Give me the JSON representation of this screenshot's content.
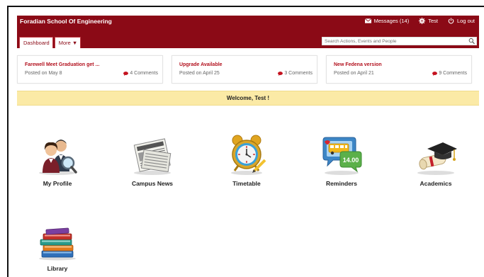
{
  "header": {
    "school_name": "Foradian School Of Engineering",
    "messages_label": "Messages (14)",
    "user_label": "Test",
    "logout_label": "Log out",
    "search_placeholder": "Search Actions, Events and People"
  },
  "tabs": [
    {
      "label": "Dashboard"
    },
    {
      "label": "More ▼"
    }
  ],
  "news": [
    {
      "title": "Farewell Meet Graduation get ...",
      "date": "Posted on May 8",
      "comments": "4 Comments"
    },
    {
      "title": "Upgrade Available",
      "date": "Posted on April 25",
      "comments": "3 Comments"
    },
    {
      "title": "New Fedena version",
      "date": "Posted on April 21",
      "comments": "9 Comments"
    }
  ],
  "welcome": "Welcome, Test !",
  "apps": [
    {
      "label": "My Profile",
      "icon": "profile-icon"
    },
    {
      "label": "Campus News",
      "icon": "newspaper-icon"
    },
    {
      "label": "Timetable",
      "icon": "alarm-clock-icon"
    },
    {
      "label": "Reminders",
      "icon": "reminders-icon"
    },
    {
      "label": "Academics",
      "icon": "graduation-cap-icon"
    },
    {
      "label": "Library",
      "icon": "books-icon"
    }
  ],
  "colors": {
    "brand": "#8b0a16",
    "accent_red": "#b3121f",
    "welcome_bg": "#fbeaa6"
  }
}
